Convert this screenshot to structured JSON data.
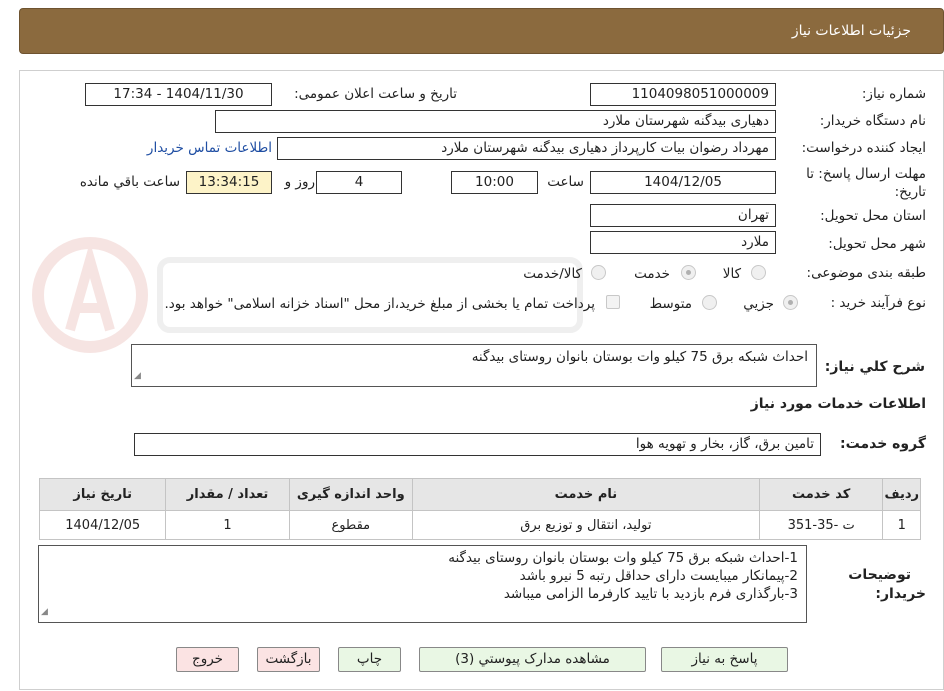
{
  "header": {
    "title": "جزئیات اطلاعات نیاز"
  },
  "form": {
    "need_number_label": "شماره نیاز:",
    "need_number": "1104098051000009",
    "announce_label": "تاریخ و ساعت اعلان عمومی:",
    "announce_value": "1404/11/30 - 17:34",
    "buyer_org_label": "نام دستگاه خریدار:",
    "buyer_org": "دهیاری بیدگنه شهرستان ملارد",
    "requester_label": "ایجاد کننده درخواست:",
    "requester": "مهرداد رضوان بیات کارپرداز دهیاری بیدگنه شهرستان ملارد",
    "contact_link": "اطلاعات تماس خریدار",
    "deadline_label_1": "مهلت ارسال پاسخ: تا",
    "deadline_label_2": "تاریخ:",
    "deadline_date": "1404/12/05",
    "time_word": "ساعت",
    "deadline_time": "10:00",
    "days": "4",
    "days_word": "روز و",
    "remaining_time": "13:34:15",
    "remaining_word": "ساعت باقي مانده",
    "province_label": "استان محل تحویل:",
    "province": "تهران",
    "city_label": "شهر محل تحویل:",
    "city": "ملارد",
    "category_label": "طبقه بندی موضوعی:",
    "category_goods": "کالا",
    "category_service": "خدمت",
    "category_goods_service": "کالا/خدمت",
    "process_label": "نوع فرآیند خرید :",
    "process_partial": "جزیي",
    "process_medium": "متوسط",
    "payment_note": "پرداخت تمام یا بخشی از مبلغ خرید،از محل \"اسناد خزانه اسلامی\" خواهد بود.",
    "summary_label": "شرح کلي نیاز:",
    "summary": "احداث شبکه برق 75 کیلو وات بوستان بانوان روستای بیدگنه",
    "services_title": "اطلاعات خدمات مورد نیاز",
    "service_group_label": "گروه خدمت:",
    "service_group": "تامین برق، گاز، بخار و تهویه هوا"
  },
  "table": {
    "headers": [
      "ردیف",
      "کد خدمت",
      "نام خدمت",
      "واحد اندازه گیری",
      "تعداد / مقدار",
      "تاریخ نیاز"
    ],
    "rows": [
      [
        "1",
        "ت -35-351",
        "تولید، انتقال و توزیع برق",
        "مقطوع",
        "1",
        "1404/12/05"
      ]
    ]
  },
  "buyer_notes": {
    "label_1": "توضیحات",
    "label_2": "خریدار:",
    "lines": [
      "1-احداث شبکه برق 75 کیلو وات بوستان بانوان روستای بیدگنه",
      "2-پیمانکار میبایست دارای حداقل رتبه 5 نیرو باشد",
      "3-بارگذاری فرم بازدید با تایید کارفرما الزامی میباشد"
    ]
  },
  "buttons": {
    "reply": "پاسخ به نیاز",
    "attachments": "مشاهده مدارک پیوستي (3)",
    "print": "چاپ",
    "back": "بازگشت",
    "exit": "خروج"
  },
  "colors": {
    "header_bg": "#8b6a3e",
    "link": "#1f4ea3",
    "highlight": "#fdf3c8",
    "green_button": "#e9f7e4",
    "pink_button": "#fbe3e3"
  }
}
